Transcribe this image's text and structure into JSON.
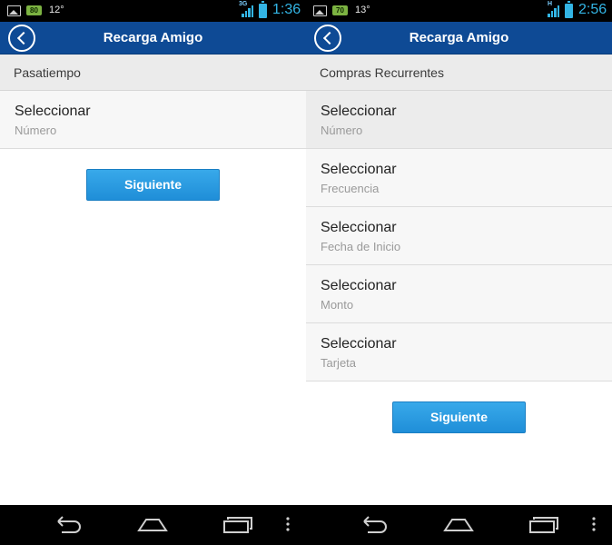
{
  "screens": [
    {
      "status": {
        "battery_badge": "80",
        "temp": "12°",
        "network": "3G",
        "time": "1:36"
      },
      "header": {
        "title": "Recarga Amigo"
      },
      "section": {
        "label": "Pasatiempo"
      },
      "rows": [
        {
          "label": "Seleccionar",
          "sub": "Número"
        }
      ],
      "button": {
        "label": "Siguiente"
      }
    },
    {
      "status": {
        "battery_badge": "70",
        "temp": "13°",
        "network": "H",
        "time": "2:56"
      },
      "header": {
        "title": "Recarga Amigo"
      },
      "section": {
        "label": "Compras Recurrentes"
      },
      "rows": [
        {
          "label": "Seleccionar",
          "sub": "Número"
        },
        {
          "label": "Seleccionar",
          "sub": "Frecuencia"
        },
        {
          "label": "Seleccionar",
          "sub": "Fecha de Inicio"
        },
        {
          "label": "Seleccionar",
          "sub": "Monto"
        },
        {
          "label": "Seleccionar",
          "sub": "Tarjeta"
        }
      ],
      "button": {
        "label": "Siguiente"
      }
    }
  ],
  "icons": {
    "status_left": [
      "image-icon",
      "battery-badge-icon"
    ],
    "status_right": [
      "signal-icon",
      "battery-icon"
    ],
    "header": "back-circle-icon",
    "nav": [
      "nav-back-icon",
      "nav-home-icon",
      "nav-recents-icon",
      "nav-menu-icon"
    ]
  },
  "colors": {
    "header_bg": "#0e4a95",
    "accent": "#33b5e5",
    "button": "#2a9be0"
  }
}
